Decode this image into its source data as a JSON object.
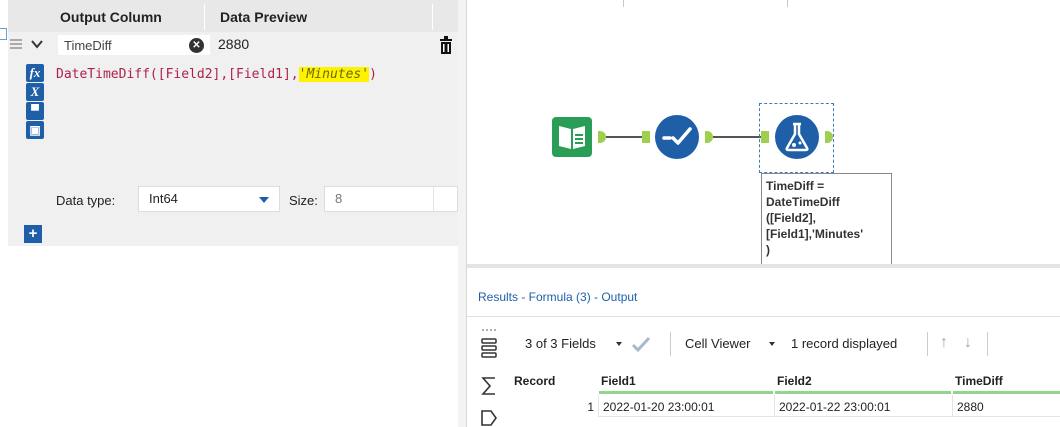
{
  "config": {
    "headers": {
      "output_column": "Output Column",
      "data_preview": "Data Preview"
    },
    "formula": {
      "output_name": "TimeDiff",
      "preview": "2880",
      "expression_prefix": "DateTimeDiff([Field2],[Field1],",
      "expression_highlight": "'Minutes'",
      "expression_suffix": ")"
    },
    "tools": [
      "fx-icon",
      "variable-icon",
      "open-folder-icon",
      "save-icon"
    ],
    "type_row": {
      "type_label": "Data type:",
      "type_value": "Int64",
      "size_label": "Size:",
      "size_value": "8"
    },
    "add_label": "+"
  },
  "canvas": {
    "tooltip": "TimeDiff =\nDateTimeDiff\n([Field2],\n[Field1],'Minutes'\n)",
    "tool_icons": [
      "input-data-icon",
      "select-tool-icon",
      "formula-tool-icon"
    ],
    "colors": {
      "input": "#2a9d57",
      "select": "#1f5fa8",
      "formula": "#1f5fa8",
      "anchor": "#9fcf4f"
    }
  },
  "results": {
    "title": "Results - Formula (3) - Output",
    "fields_label": "3 of 3 Fields",
    "cell_viewer": "Cell Viewer",
    "records_label": "1 record displayed",
    "columns": [
      "Record",
      "Field1",
      "Field2",
      "TimeDiff"
    ],
    "rows": [
      [
        "1",
        "2022-01-20 23:00:01",
        "2022-01-22 23:00:01",
        "2880"
      ]
    ]
  }
}
